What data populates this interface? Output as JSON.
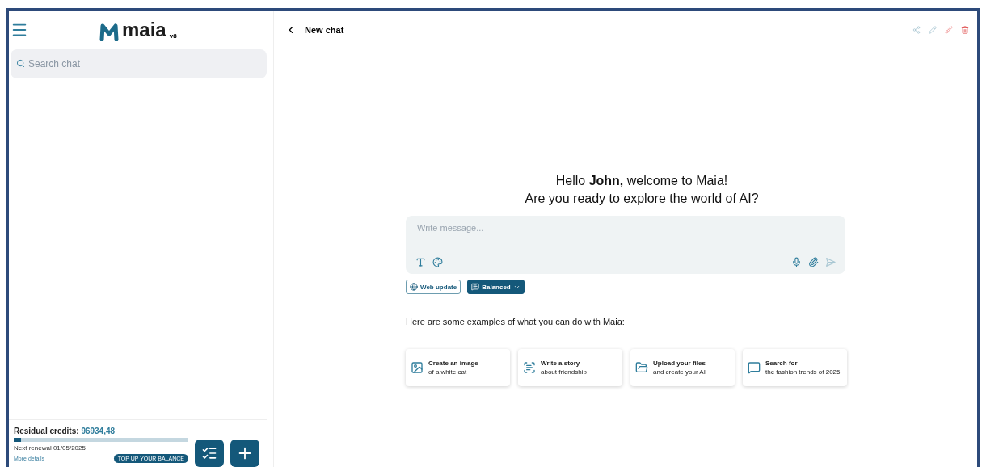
{
  "sidebar": {
    "logo": {
      "name": "maia",
      "version": "v8"
    },
    "search": {
      "placeholder": "Search chat"
    },
    "credits": {
      "label": "Residual credits:",
      "value": "96934,48",
      "level": 0.04,
      "renewal": "Next renewal 01/05/2025",
      "details_link": "More details",
      "top_up_button": "TOP UP YOUR BALANCE"
    }
  },
  "header": {
    "title": "New chat"
  },
  "welcome": {
    "greeting": "Hello **John,** welcome to Maia!",
    "subtitle": "Are you ready to explore the world of AI?"
  },
  "composer": {
    "placeholder": "Write message..."
  },
  "options": [
    {
      "kind": "outline",
      "label": "Web update"
    },
    {
      "kind": "filled",
      "label": "Balanced"
    }
  ],
  "examples_heading": "Here are some examples of what you can do with Maia:",
  "examples": [
    {
      "kind": "image",
      "title": "Create an image",
      "subtitle": "of a white cat"
    },
    {
      "kind": "story",
      "title": "Write a story",
      "subtitle": "about friendship"
    },
    {
      "kind": "upload",
      "title": "Upload your files",
      "subtitle": "and create your AI"
    },
    {
      "kind": "search",
      "title": "Search for",
      "subtitle": "the fashion trends of 2025"
    }
  ]
}
